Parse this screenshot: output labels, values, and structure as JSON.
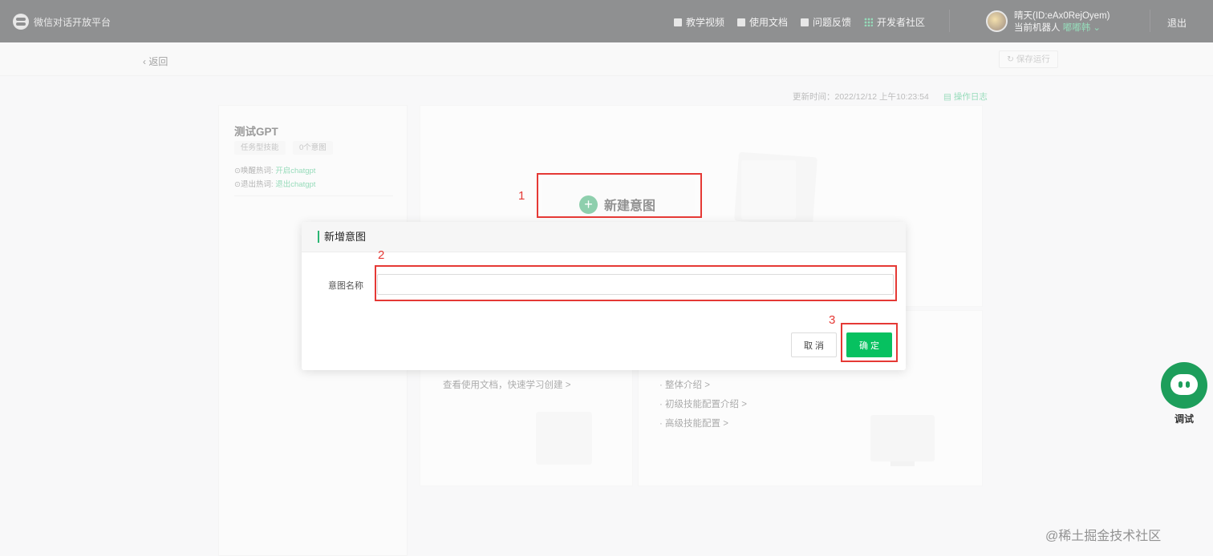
{
  "topbar": {
    "app_title": "微信对话开放平台",
    "nav": [
      "教学视频",
      "使用文档",
      "问题反馈",
      "开发者社区"
    ],
    "user_name": "晴天(ID:eAx0RejOyem)",
    "robot_prefix": "当前机器人",
    "robot_name": "嘟嘟韩",
    "logout": "退出"
  },
  "subbar": {
    "back": "返回",
    "save_run": "保存运行"
  },
  "meta": {
    "update_time": "更新时间：2022/12/12 上午10:23:54",
    "op_log": "操作日志"
  },
  "skill": {
    "title": "测试GPT",
    "tags": [
      "任务型技能",
      "0个意图"
    ],
    "wake_label": "唤醒热词:",
    "wake_value": "开启chatgpt",
    "exit_label": "退出热词:",
    "exit_value": "退出chatgpt"
  },
  "main": {
    "new_intent": "新建意图",
    "doc_link": "查看使用文档，快速学习创建 >",
    "intros": [
      "整体介绍 >",
      "初级技能配置介绍 >",
      "高级技能配置 >"
    ]
  },
  "dialog": {
    "title": "新增意图",
    "field_label": "意图名称",
    "field_value": "",
    "cancel": "取 消",
    "confirm": "确 定"
  },
  "annotations": [
    "1",
    "2",
    "3"
  ],
  "bot": {
    "label": "调试"
  },
  "watermark": "@稀土掘金技术社区",
  "colors": {
    "accent": "#07c160",
    "annotation": "#e53935",
    "topbar": "#1f2023"
  }
}
